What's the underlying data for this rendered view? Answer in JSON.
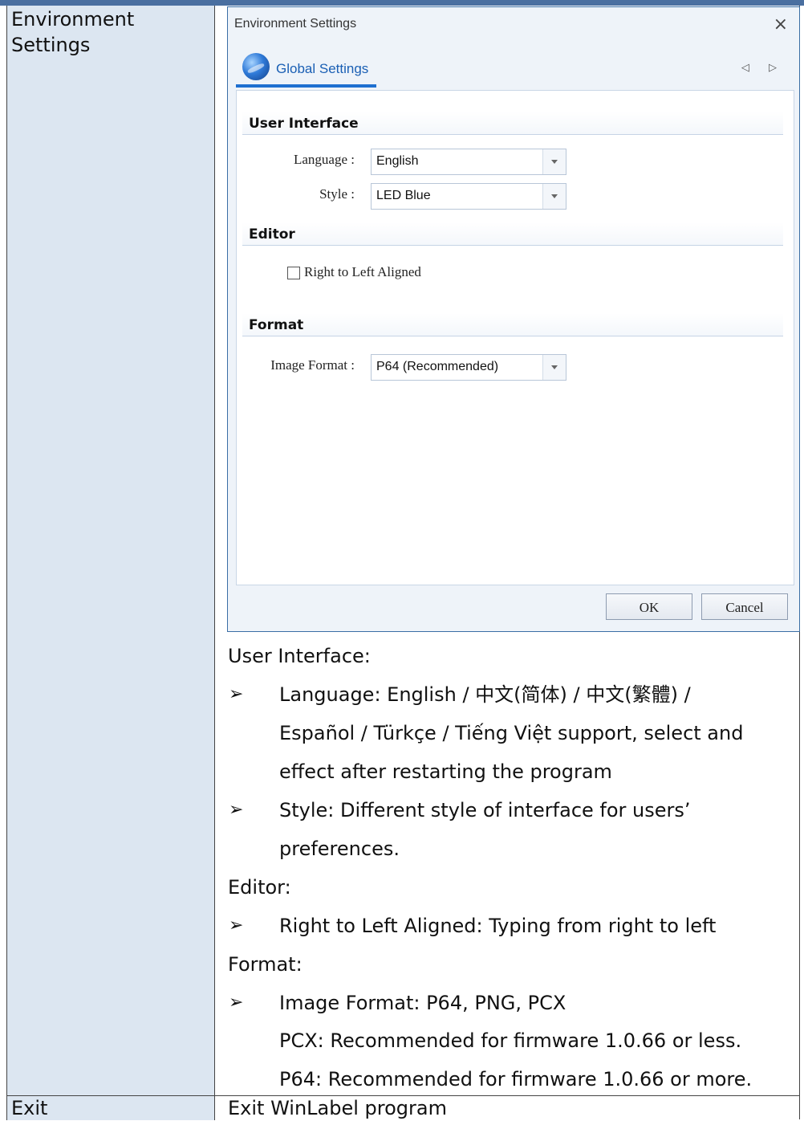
{
  "table": {
    "row1_term_line1": "Environment",
    "row1_term_line2": "Settings",
    "row2_term": "Exit",
    "row2_desc": "Exit WinLabel program"
  },
  "dialog": {
    "title": "Environment Settings",
    "close_glyph": "×",
    "tab_label": "Global Settings",
    "tab_arrows": "◁ ▷",
    "sections": {
      "ui": "User Interface",
      "editor": "Editor",
      "format": "Format"
    },
    "language_label": "Language :",
    "language_value": "English",
    "style_label": "Style :",
    "style_value": "LED Blue",
    "rtl_label": "Right to Left Aligned",
    "image_format_label": "Image Format :",
    "image_format_value": "P64 (Recommended)",
    "ok_label": "OK",
    "cancel_label": "Cancel"
  },
  "description": {
    "ui_heading": "User Interface:",
    "bullet_glyph": "➢",
    "lang_line1": "Language: English / 中文(简体) / 中文(繁體) /",
    "lang_line2": "Español / Türkçe / Tiếng Việt support, select and",
    "lang_line3": "effect after restarting the program",
    "style_line1": "Style: Different style of interface for users’",
    "style_line2": "preferences.",
    "editor_heading": "Editor:",
    "rtl_line": "Right to Left Aligned: Typing from right to left",
    "format_heading": "Format:",
    "imgfmt_line": "Image Format: P64, PNG, PCX",
    "pcx_line": "PCX: Recommended for firmware 1.0.66 or less.",
    "p64_line": "P64: Recommended for firmware 1.0.66 or more."
  },
  "colors": {
    "left_column_bg": "#dce6f1",
    "dialog_accent": "#1e6fd0"
  }
}
